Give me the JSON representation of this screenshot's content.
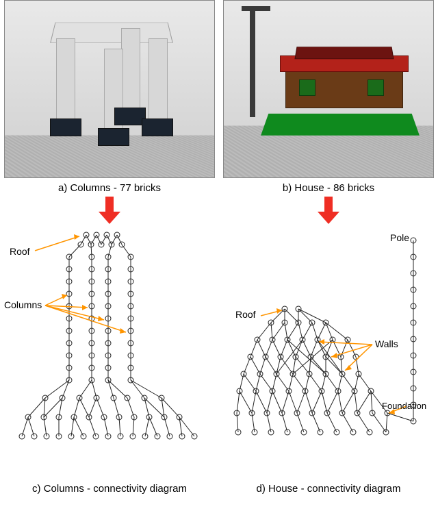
{
  "panels": {
    "a": {
      "caption": "a) Columns - 77 bricks"
    },
    "b": {
      "caption": "b) House - 86 bricks"
    },
    "c": {
      "caption": "c) Columns - connectivity diagram",
      "labels": {
        "roof": "Roof",
        "columns": "Columns"
      }
    },
    "d": {
      "caption": "d) House - connectivity diagram",
      "labels": {
        "roof": "Roof",
        "walls": "Walls",
        "pole": "Pole",
        "foundation": "Foundation"
      }
    }
  },
  "structure": {
    "type": "2x2 figure",
    "top_row": "3D LEGO renderings",
    "bottom_row": "brick connectivity graphs (nodes = bricks, edges = physical connections)"
  },
  "models": {
    "columns": {
      "brick_count": 77,
      "parts": [
        "roof slab",
        "4 vertical columns",
        "black feet/bases"
      ]
    },
    "house": {
      "brick_count": 86,
      "parts": [
        "green baseplate",
        "brown walls with windows",
        "red roof",
        "tall gray pole with sign"
      ]
    }
  }
}
